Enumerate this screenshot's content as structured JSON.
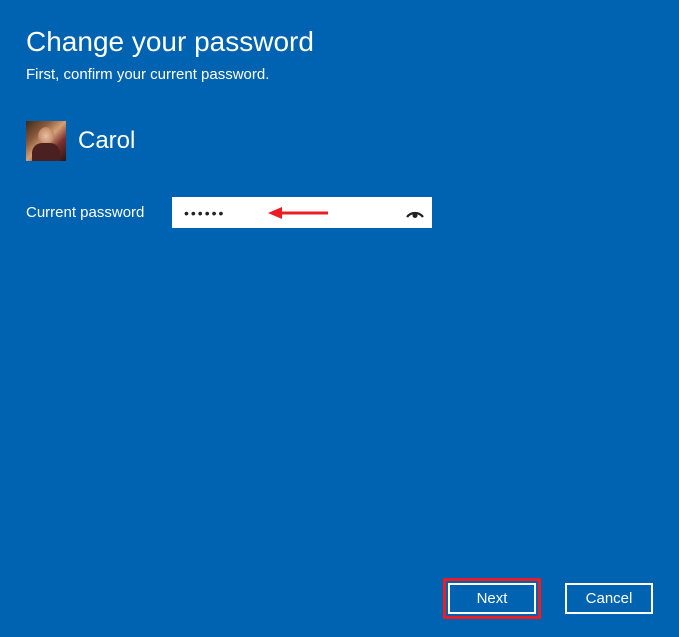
{
  "title": "Change your password",
  "subtitle": "First, confirm your current password.",
  "user": {
    "name": "Carol"
  },
  "field": {
    "label": "Current password",
    "value": "••••••"
  },
  "buttons": {
    "next": "Next",
    "cancel": "Cancel"
  }
}
